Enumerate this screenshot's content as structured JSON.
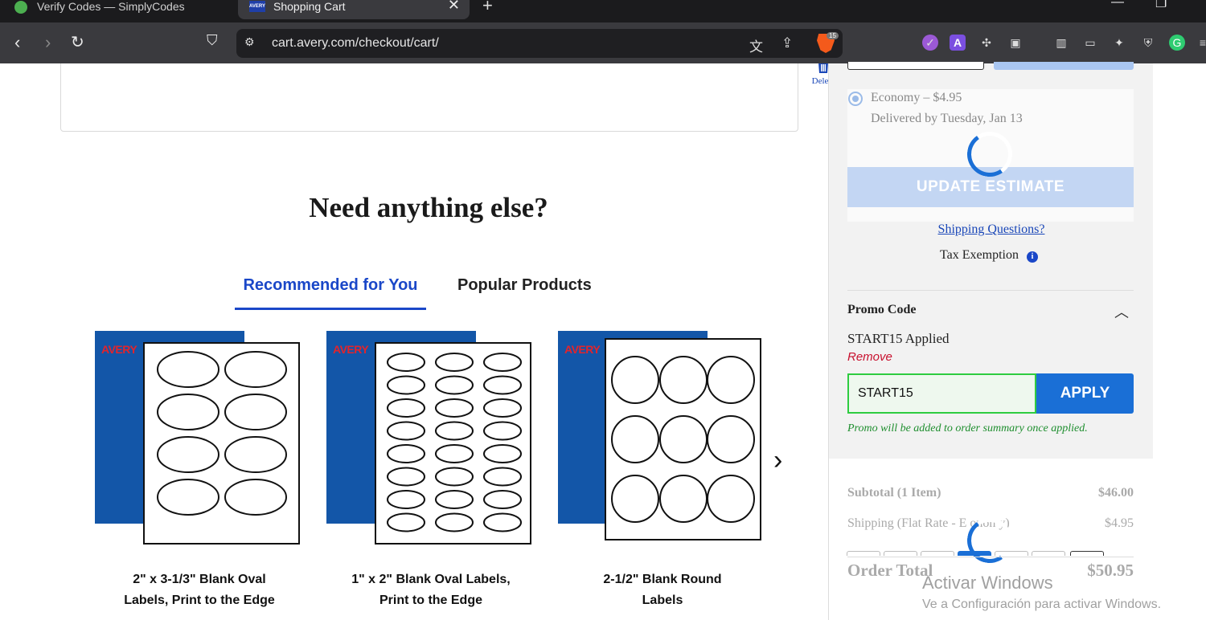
{
  "browser": {
    "tabs": [
      {
        "title": "Verify Codes — SimplyCodes"
      },
      {
        "title": "Shopping Cart",
        "icon_text": "AVERY"
      }
    ],
    "url": "cart.avery.com/checkout/cart/",
    "brave_badge": "15"
  },
  "cart": {
    "delete_label": "Delete"
  },
  "recommend": {
    "title": "Need anything else?",
    "tabs": [
      "Recommended for You",
      "Popular Products"
    ],
    "products": [
      {
        "name_line1": "2\" x 3-1/3\" Blank Oval",
        "name_line2": "Labels, Print to the Edge"
      },
      {
        "name_line1": "1\" x 2\" Blank Oval Labels,",
        "name_line2": "Print to the Edge"
      },
      {
        "name_line1": "2-1/2\" Blank Round",
        "name_line2": "Labels"
      }
    ],
    "brand": "AVERY"
  },
  "shipping": {
    "option": "Economy – $4.95",
    "delivery": "Delivered by Tuesday, Jan 13",
    "update_label": "UPDATE ESTIMATE",
    "questions_link": "Shipping Questions?",
    "tax_label": "Tax Exemption"
  },
  "promo": {
    "title": "Promo Code",
    "applied": "START15 Applied",
    "remove": "Remove",
    "input_value": "START15",
    "apply_label": "APPLY",
    "note": "Promo will be added to order summary once applied."
  },
  "summary": {
    "subtotal_label": "Subtotal (1 Item)",
    "subtotal_value": "$46.00",
    "shipping_label": "Shipping (Flat Rate - E  onon  y)",
    "shipping_value": "$4.95",
    "total_label": "Order Total",
    "total_value": "$50.95"
  },
  "watermark": {
    "line1": "Activar Windows",
    "line2": "Ve a Configuración para activar Windows."
  },
  "colors": {
    "accent": "#1a47c8",
    "apply_button": "#1a6fd6",
    "promo_success": "#2ecc40",
    "avery_blue": "#1356a8"
  }
}
